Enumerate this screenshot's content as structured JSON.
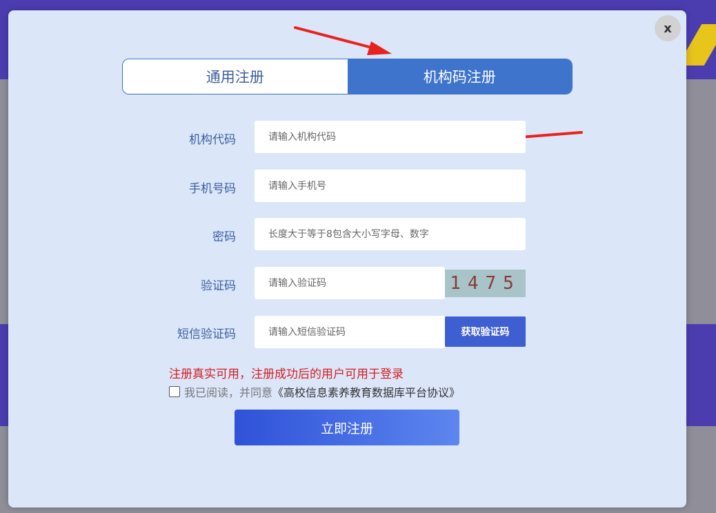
{
  "modal": {
    "close_label": "x",
    "tabs": [
      {
        "label": "通用注册",
        "active": false
      },
      {
        "label": "机构码注册",
        "active": true
      }
    ],
    "fields": [
      {
        "label": "机构代码",
        "placeholder": "请输入机构代码"
      },
      {
        "label": "手机号码",
        "placeholder": "请输入手机号"
      },
      {
        "label": "密码",
        "placeholder": "长度大于等于8包含大小写字母、数字"
      },
      {
        "label": "验证码",
        "placeholder": "请输入验证码"
      },
      {
        "label": "短信验证码",
        "placeholder": "请输入短信验证码"
      }
    ],
    "captcha_text": "1475",
    "sms_button": "获取验证码",
    "notice": "注册真实可用，注册成功后的用户可用于登录",
    "agree_text": "我已阅读，并同意",
    "agree_link": "《高校信息素养教育数据库平台协议》",
    "submit": "立即注册"
  },
  "colors": {
    "accent": "#3e74cc",
    "modal_bg": "#dbe6f9",
    "notice": "#d61e1e",
    "annotation_arrow": "#e8231f"
  },
  "icons": [
    "close-icon",
    "annotation-arrow"
  ]
}
